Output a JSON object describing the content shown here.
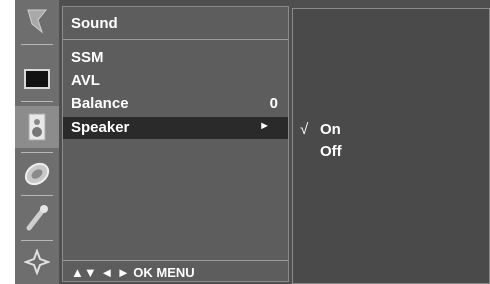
{
  "icons": [
    {
      "name": "picture-icon"
    },
    {
      "name": "screen-icon"
    },
    {
      "name": "sound-icon"
    },
    {
      "name": "time-icon"
    },
    {
      "name": "special-icon"
    },
    {
      "name": "setup-icon"
    }
  ],
  "menu": {
    "title": "Sound",
    "items": [
      {
        "label": "SSM",
        "value": ""
      },
      {
        "label": "AVL",
        "value": ""
      },
      {
        "label": "Balance",
        "value": "0"
      },
      {
        "label": "Speaker",
        "value": "►"
      }
    ],
    "selected_index": 3,
    "nav_hint": "▲▼  ◄ ►  OK  MENU"
  },
  "submenu": {
    "items": [
      {
        "label": "On",
        "check": "√"
      },
      {
        "label": "Off",
        "check": ""
      }
    ]
  }
}
